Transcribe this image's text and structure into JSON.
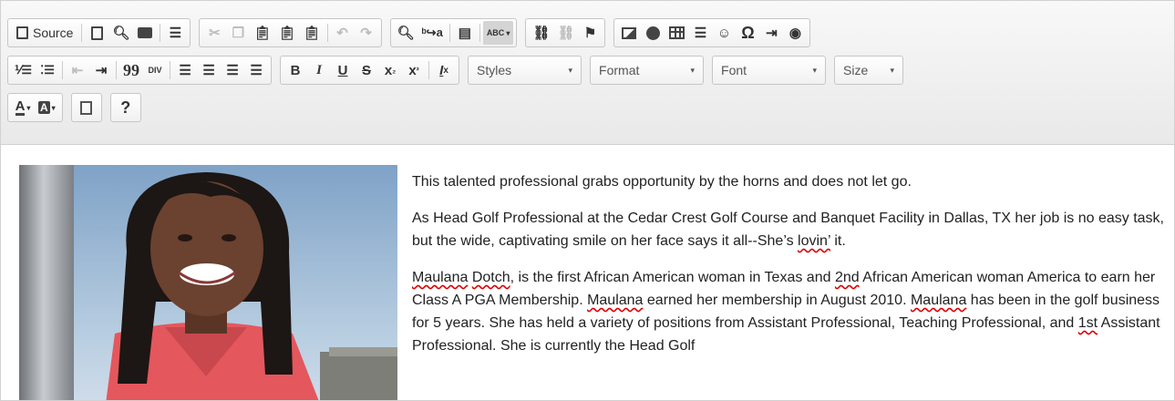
{
  "toolbar": {
    "source_label": "Source",
    "styles_label": "Styles",
    "format_label": "Format",
    "font_label": "Font",
    "size_label": "Size",
    "help_label": "?",
    "bold": "B",
    "italic": "I",
    "underline": "U",
    "strike": "S",
    "subscript": "x",
    "subscript_mark": "₂",
    "superscript": "x",
    "superscript_mark": "²",
    "remove_format": "I",
    "remove_format_mark": "x",
    "text_color": "A",
    "bg_color": "A",
    "blockquote": "99",
    "creatediv": "DIV",
    "special_char": "Ω",
    "spellcheck": "ABC"
  },
  "icons": [
    "source-icon",
    "new-page-icon",
    "preview-icon",
    "print-icon",
    "templates-icon",
    "cut-icon",
    "copy-icon",
    "paste-icon",
    "paste-text-icon",
    "paste-word-icon",
    "undo-icon",
    "redo-icon",
    "find-icon",
    "replace-icon",
    "select-all-icon",
    "spellcheck-icon",
    "link-icon",
    "unlink-icon",
    "anchor-icon",
    "image-icon",
    "flash-icon",
    "table-icon",
    "horizontal-rule-icon",
    "smiley-icon",
    "special-char-icon",
    "page-break-icon",
    "iframe-icon",
    "numbered-list-icon",
    "bulleted-list-icon",
    "outdent-icon",
    "indent-icon",
    "blockquote-icon",
    "creatediv-icon",
    "align-left-icon",
    "align-center-icon",
    "align-right-icon",
    "justify-icon",
    "text-color-icon",
    "bg-color-icon",
    "maximize-icon",
    "help-icon"
  ],
  "content": {
    "p1": "This talented professional grabs opportunity by the horns and does not let go.",
    "p2_a": "As Head Golf Professional at the Cedar Crest Golf Course and Banquet Facility in Dallas, TX her job is no easy task, but the wide, captivating smile on her face says it all--She’s ",
    "p2_w1": "lovin’",
    "p2_b": " it.",
    "p3_w1": "Maulana",
    "p3_s1": " ",
    "p3_w2": "Dotch",
    "p3_s2": ", is the first African American woman in Texas and ",
    "p3_w3": "2nd",
    "p3_s3": " African American woman America to earn her Class A PGA Membership. ",
    "p3_w4": "Maulana",
    "p3_s4": " earned her membership in August 2010. ",
    "p3_w5": "Maulana",
    "p3_s5": " has been in the golf business for 5 years. She has held a variety of positions from Assistant Professional, Teaching Professional, and ",
    "p3_w6": "1st",
    "p3_s6": " Assistant Professional. She is currently the Head Golf"
  },
  "colors": {
    "toolbar_bg": "#efefef",
    "text": "#222222",
    "spell_underline": "#dd0000",
    "shirt": "#e8585e",
    "sky": "#a9c3dc"
  }
}
